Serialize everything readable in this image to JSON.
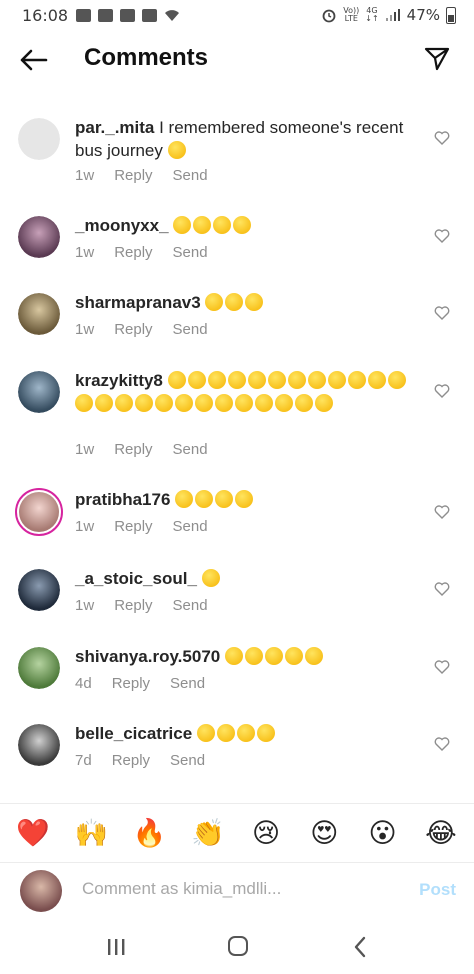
{
  "status_bar": {
    "time": "16:08",
    "battery": "47%",
    "network_top": "Vo))",
    "network_bottom": "LTE",
    "gen_top": "4G",
    "gen_bottom": "↓↑"
  },
  "header": {
    "title": "Comments"
  },
  "comments": [
    {
      "username": "par._.mita",
      "text": "I remembered someone's recent bus journey",
      "emoji_count": 1,
      "age": "1w",
      "reply": "Reply",
      "send": "Send"
    },
    {
      "username": "_moonyxx_",
      "text": "",
      "emoji_count": 4,
      "age": "1w",
      "reply": "Reply",
      "send": "Send"
    },
    {
      "username": "sharmapranav3",
      "text": "",
      "emoji_count": 3,
      "age": "1w",
      "reply": "Reply",
      "send": "Send"
    },
    {
      "username": "krazykitty8",
      "text": "",
      "emoji_count": 25,
      "age": "1w",
      "reply": "Reply",
      "send": "Send"
    },
    {
      "username": "pratibha176",
      "text": "",
      "emoji_count": 4,
      "age": "1w",
      "reply": "Reply",
      "send": "Send"
    },
    {
      "username": "_a_stoic_soul_",
      "text": "",
      "emoji_count": 1,
      "age": "1w",
      "reply": "Reply",
      "send": "Send"
    },
    {
      "username": "shivanya.roy.5070",
      "text": "",
      "emoji_count": 5,
      "age": "4d",
      "reply": "Reply",
      "send": "Send"
    },
    {
      "username": "belle_cicatrice",
      "text": "",
      "emoji_count": 4,
      "age": "7d",
      "reply": "Reply",
      "send": "Send"
    }
  ],
  "quick_emojis": [
    "❤️",
    "🙌",
    "🔥",
    "👏",
    "😢",
    "😍",
    "😮",
    "😂"
  ],
  "composer": {
    "placeholder": "Comment as kimia_mdlli...",
    "post_label": "Post"
  },
  "colors": {
    "story_ring": "#d6249f",
    "post_disabled": "#b2dffc",
    "meta_gray": "#8e8e8e"
  }
}
